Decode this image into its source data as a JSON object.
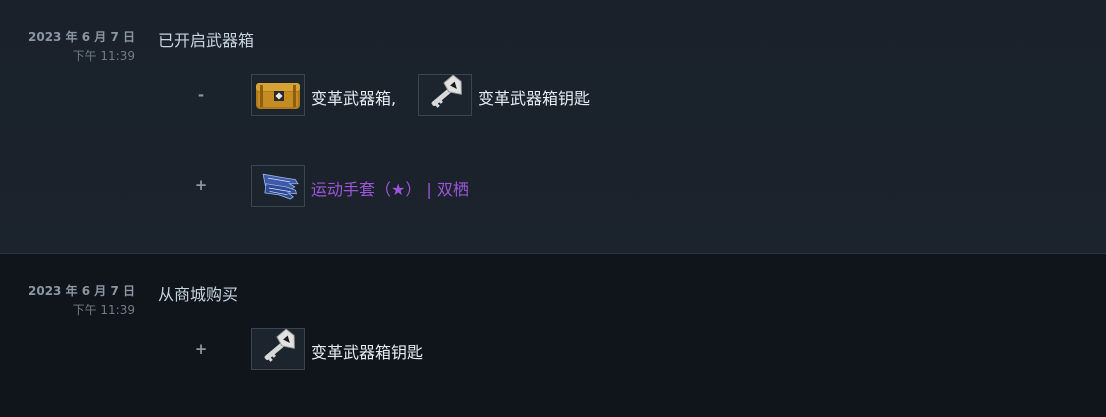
{
  "entries": [
    {
      "date": "2023 年 6 月 7 日",
      "time": "下午 11:39",
      "description": "已开启武器箱",
      "removed": {
        "sign": "-",
        "items": [
          {
            "name": "变革武器箱,",
            "icon": "weapon-case-icon"
          },
          {
            "name": "变革武器箱钥匙",
            "icon": "case-key-icon"
          }
        ]
      },
      "added": {
        "sign": "+",
        "items": [
          {
            "name": "运动手套（★） | 双栖",
            "icon": "gloves-icon",
            "color": "#9c55d8"
          }
        ]
      }
    },
    {
      "date": "2023 年 6 月 7 日",
      "time": "下午 11:39",
      "description": "从商城购买",
      "added": {
        "sign": "+",
        "items": [
          {
            "name": "变革武器箱钥匙",
            "icon": "case-key-icon"
          }
        ]
      }
    }
  ]
}
